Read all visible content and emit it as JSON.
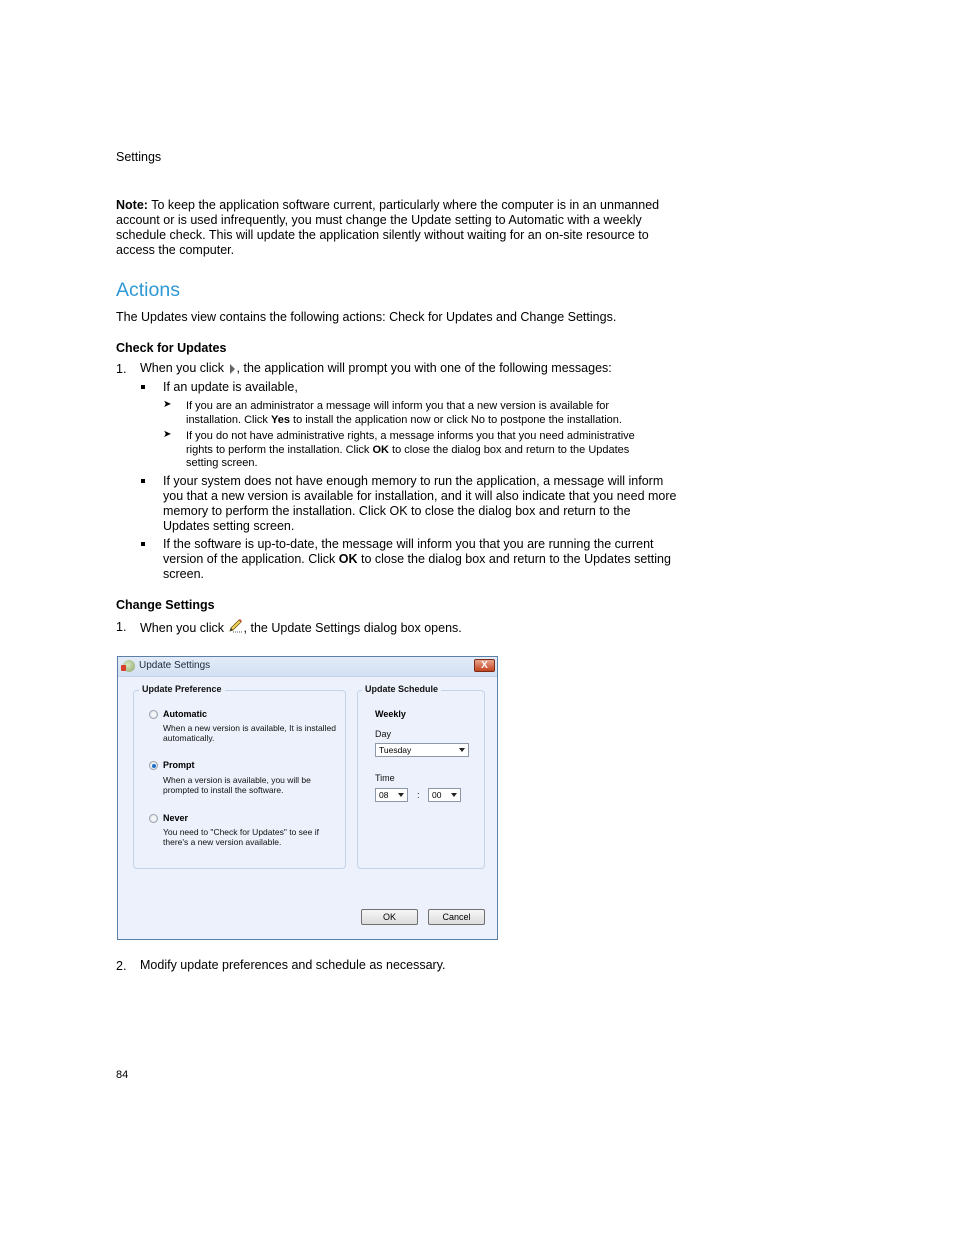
{
  "page": {
    "header_label": "Settings",
    "page_number": "84"
  },
  "note": {
    "label": "Note:",
    "text": " To keep the application software current, particularly where the computer is in an unmanned account or is used infrequently, you must change the Update setting to Automatic with a weekly schedule check. This will update the application silently without waiting for an on-site resource to access the computer."
  },
  "actions": {
    "heading": "Actions",
    "intro": "The Updates view contains the following actions: Check for Updates and Change Settings."
  },
  "check_for_updates": {
    "heading": "Check for Updates",
    "step1_num": "1.",
    "step1_before": "When you click",
    "step1_icon": "play-triangle-icon",
    "step1_after": ", the application will prompt you with one of the following messages:",
    "bullet1": "If an update is available,",
    "sub1_a": "If you are an administrator a message will inform you that a new version is available for",
    "sub1_b_pre": "installation. Click ",
    "sub1_b_bold": "Yes",
    "sub1_b_post": " to install the application now or click No to postpone the installation.",
    "sub2_a": "If you do not have administrative rights, a message informs you that you need administrative",
    "sub2_b_pre": "rights to perform the installation. Click ",
    "sub2_b_bold": "OK",
    "sub2_b_post": " to close the dialog box and return to the Updates",
    "sub2_c": "setting screen.",
    "bullet2": "If your system does not have enough memory to run the application, a message will inform you that a new version is available for installation, and it will also indicate that you need more memory to perform the installation. Click OK to close the dialog box and return to the Updates setting screen.",
    "bullet3_pre": "If the software is up-to-date, the message will inform you that you are running the current version of the application. Click ",
    "bullet3_bold": "OK",
    "bullet3_post": " to close the dialog box and return to the Updates setting screen."
  },
  "change_settings": {
    "heading": "Change Settings",
    "step1_num": "1.",
    "step1_before": "When you click",
    "step1_icon": "pencil-icon",
    "step1_after": ", the Update Settings dialog box opens.",
    "step2_num": "2.",
    "step2_text": "Modify update preferences and schedule as necessary."
  },
  "dialog": {
    "title": "Update Settings",
    "close_label": "X",
    "preference_group": "Update Preference",
    "options": [
      {
        "label": "Automatic",
        "desc": "When a new version is available, It is installed automatically.",
        "checked": false
      },
      {
        "label": "Prompt",
        "desc": "When a version is available, you will be prompted to install the software.",
        "checked": true
      },
      {
        "label": "Never",
        "desc": "You need to \"Check for Updates\" to see if there's a new version available.",
        "checked": false
      }
    ],
    "schedule_group": "Update Schedule",
    "frequency": "Weekly",
    "day_label": "Day",
    "day_value": "Tuesday",
    "time_label": "Time",
    "hour_value": "08",
    "time_separator": ":",
    "minute_value": "00",
    "ok_label": "OK",
    "cancel_label": "Cancel"
  }
}
